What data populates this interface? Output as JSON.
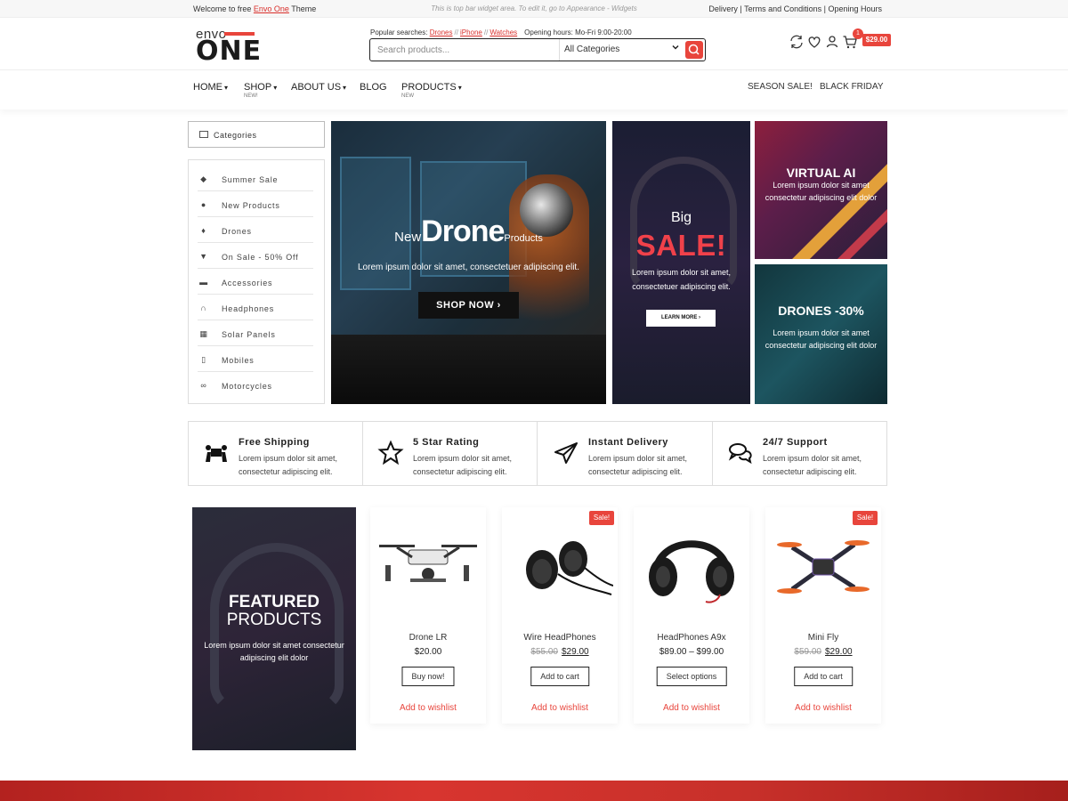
{
  "topbar": {
    "welcome_prefix": "Welcome to free ",
    "welcome_link": "Envo One",
    "welcome_suffix": " Theme",
    "center_text": "This is top bar widget area. To edit it, go to Appearance - Widgets",
    "right_links": "Delivery | Terms and Conditions | Opening Hours"
  },
  "logo": {
    "top": "envo",
    "bottom": "ONE"
  },
  "popular": {
    "label": "Popular searches: ",
    "links": [
      "Drones",
      "iPhone",
      "Watches"
    ],
    "separator": "//",
    "hours": "Opening hours: Mo-Fri 9:00-20:00"
  },
  "search": {
    "placeholder": "Search products...",
    "category": "All Categories"
  },
  "header": {
    "cart_count": "1",
    "cart_total": "$29.00"
  },
  "nav": {
    "items": [
      {
        "label": "HOME",
        "sub": ""
      },
      {
        "label": "SHOP",
        "sub": "NEW!"
      },
      {
        "label": "ABOUT US",
        "sub": ""
      },
      {
        "label": "BLOG",
        "sub": ""
      },
      {
        "label": "PRODUCTS",
        "sub": "NEW"
      }
    ],
    "right": [
      "SEASON SALE!",
      "BLACK FRIDAY"
    ]
  },
  "sidebar": {
    "title": "Categories",
    "items": [
      {
        "label": "Summer Sale",
        "icon": "tag-icon"
      },
      {
        "label": "New Products",
        "icon": "users-icon"
      },
      {
        "label": "Drones",
        "icon": "pin-icon"
      },
      {
        "label": "On Sale - 50% Off",
        "icon": "basket-icon"
      },
      {
        "label": "Accessories",
        "icon": "cart-icon"
      },
      {
        "label": "Headphones",
        "icon": "headphones-icon"
      },
      {
        "label": "Solar Panels",
        "icon": "solar-panel-icon"
      },
      {
        "label": "Mobiles",
        "icon": "mobile-icon"
      },
      {
        "label": "Motorcycles",
        "icon": "motorcycle-icon"
      }
    ]
  },
  "banners": {
    "main": {
      "pre": "New",
      "title": "Drone",
      "post": "Products",
      "text": "Lorem ipsum dolor sit amet, consectetuer adipiscing elit.",
      "button": "SHOP NOW"
    },
    "sale": {
      "big": "Big",
      "title": "SALE!",
      "text": "Lorem ipsum dolor sit amet, consectetuer adipiscing elit.",
      "button": "LEARN MORE"
    },
    "virtual": {
      "title": "VIRTUAL AI",
      "text": "Lorem ipsum dolor sit amet consectetur adipiscing elit dolor"
    },
    "drones": {
      "title": "DRONES -30%",
      "text": "Lorem ipsum dolor sit amet consectetur adipiscing elit dolor"
    }
  },
  "features": [
    {
      "title": "Free Shipping",
      "text": "Lorem ipsum dolor sit amet, consectetur adipiscing elit.",
      "icon": "shipping-icon"
    },
    {
      "title": "5 Star Rating",
      "text": "Lorem ipsum dolor sit amet, consectetur adipiscing elit.",
      "icon": "star-icon"
    },
    {
      "title": "Instant Delivery",
      "text": "Lorem ipsum dolor sit amet, consectetur adipiscing elit.",
      "icon": "paper-plane-icon"
    },
    {
      "title": "24/7 Support",
      "text": "Lorem ipsum dolor sit amet, consectetur adipiscing elit.",
      "icon": "chat-icon"
    }
  ],
  "featured": {
    "line1": "FEATURED",
    "line2": "PRODUCTS",
    "text": "Lorem ipsum dolor sit amet consectetur adipiscing elit dolor"
  },
  "products": [
    {
      "name": "Drone LR",
      "old_price": "",
      "price": "$20.00",
      "button": "Buy now!",
      "wishlist": "Add to wishlist",
      "sale": ""
    },
    {
      "name": "Wire HeadPhones",
      "old_price": "$55.00",
      "price": "$29.00",
      "button": "Add to cart",
      "wishlist": "Add to wishlist",
      "sale": "Sale!"
    },
    {
      "name": "HeadPhones A9x",
      "old_price": "",
      "price": "$89.00 – $99.00",
      "button": "Select options",
      "wishlist": "Add to wishlist",
      "sale": ""
    },
    {
      "name": "Mini Fly",
      "old_price": "$59.00",
      "price": "$29.00",
      "button": "Add to cart",
      "wishlist": "Add to wishlist",
      "sale": "Sale!"
    }
  ],
  "colors": {
    "accent": "#e8453c"
  }
}
